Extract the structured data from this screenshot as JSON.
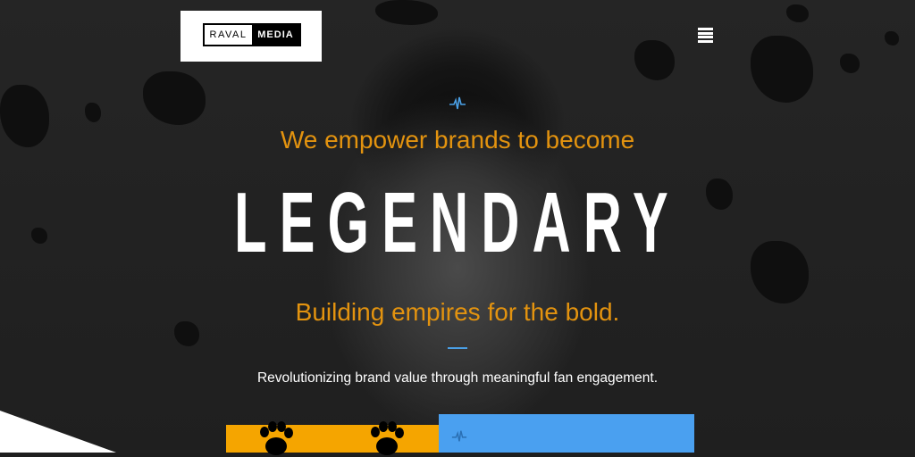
{
  "logo": {
    "left_text": "RAVAL",
    "right_text": "MEDIA"
  },
  "nav": {
    "menu_icon": "hamburger-menu-icon"
  },
  "hero": {
    "tagline_top": "We empower brands to become",
    "headline": "LEGENDARY",
    "tagline_bottom": "Building empires for the bold.",
    "subtitle": "Revolutionizing brand value through meaningful fan engagement."
  },
  "colors": {
    "accent_orange": "#e3930f",
    "accent_blue": "#4aa0f0",
    "card_yellow": "#f5a500"
  },
  "cards": [
    {
      "icon": "paw-print-icon"
    },
    {
      "icon": "pulse-icon"
    }
  ]
}
